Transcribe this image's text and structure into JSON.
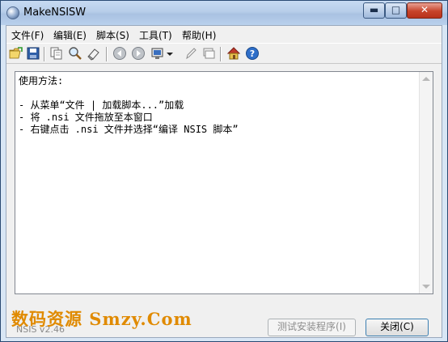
{
  "window": {
    "title": "MakeNSISW",
    "min_glyph": "▬",
    "max_glyph": "□",
    "close_glyph": "✕"
  },
  "menu": [
    {
      "label": "文件(F)"
    },
    {
      "label": "编辑(E)"
    },
    {
      "label": "脚本(S)"
    },
    {
      "label": "工具(T)"
    },
    {
      "label": "帮助(H)"
    }
  ],
  "toolbar": {
    "icons": [
      "open-icon",
      "save-icon",
      "copy-icon",
      "find-icon",
      "clear-icon",
      "back-icon",
      "forward-icon",
      "compiler-icon",
      "dropdown-arrow-icon",
      "edit-icon",
      "browse-icon",
      "home-icon",
      "help-icon"
    ]
  },
  "editor": {
    "lines": [
      "使用方法:",
      "",
      "- 从菜单“文件 | 加载脚本...”加载",
      "- 将 .nsi 文件拖放至本窗口",
      "- 右键点击 .nsi 文件并选择“编译 NSIS 脚本”"
    ]
  },
  "footer": {
    "version": "NSIS v2.46",
    "watermark": "数码资源 Smzy.Com",
    "test_button": "测试安装程序(I)",
    "close_button": "关闭(C)"
  },
  "colors": {
    "accent": "#3c7fb1",
    "watermark": "#e08a00",
    "close_button": "#c7432a"
  }
}
